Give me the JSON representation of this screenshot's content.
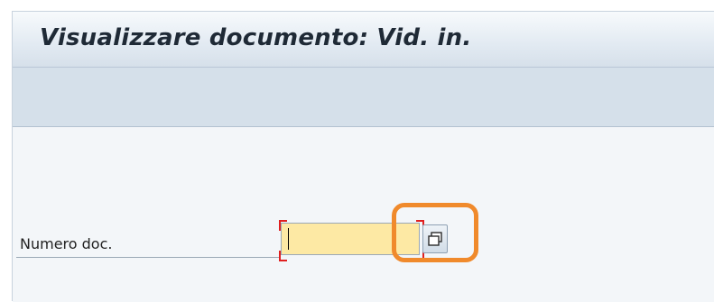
{
  "window": {
    "title": "Visualizzare documento: Vid. in."
  },
  "form": {
    "document_number": {
      "label": "Numero doc.",
      "value": "",
      "required": true
    }
  },
  "icons": {
    "value_help": "value-help-icon"
  },
  "colors": {
    "title_bar": "#e2eaf2",
    "toolbar": "#d5e0ea",
    "background": "#f3f6f9",
    "input_background": "#fde9a4",
    "required_marker": "#e02020",
    "highlight": "#f08a2c"
  }
}
